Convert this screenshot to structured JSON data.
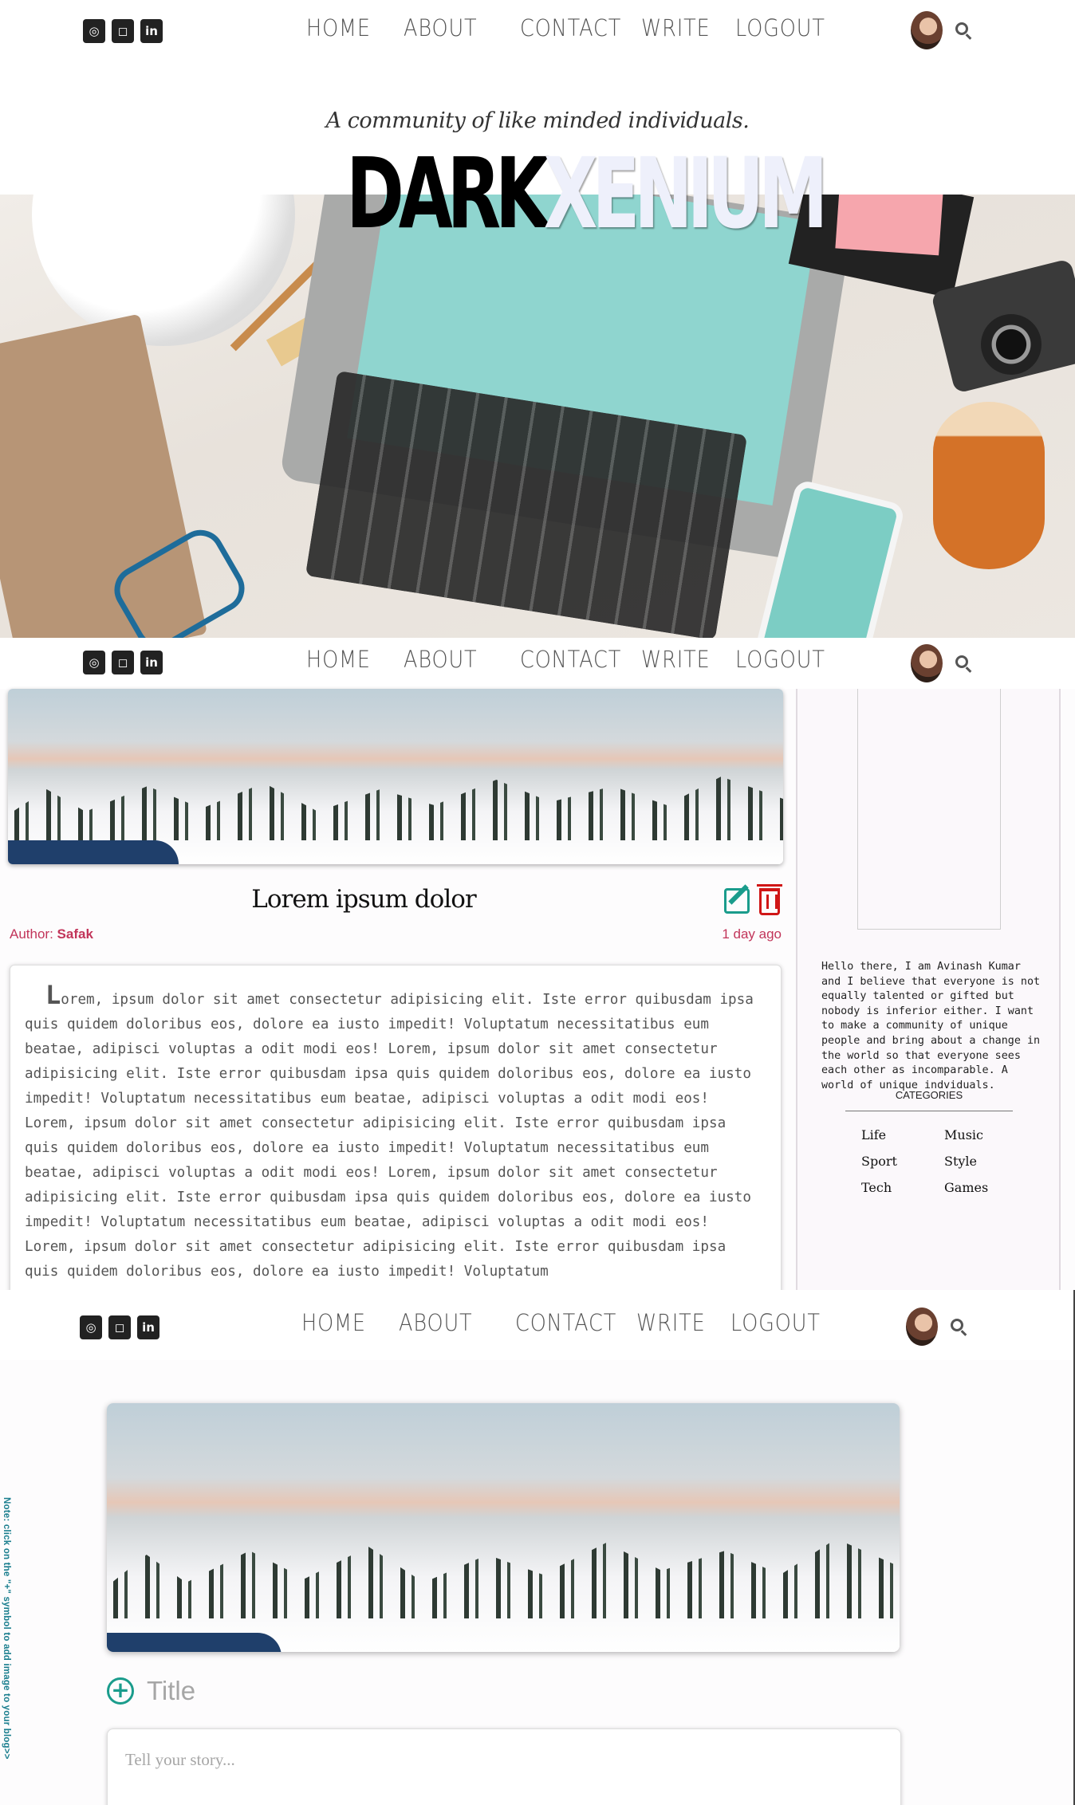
{
  "nav": {
    "social_icons": [
      "github-icon",
      "instagram-icon",
      "linkedin-icon"
    ],
    "items": [
      "HOME",
      "ABOUT",
      "CONTACT",
      "WRITE",
      "LOGOUT"
    ]
  },
  "hero": {
    "tagline": "A community of like minded individuals.",
    "logo_dark": "DARK",
    "logo_light": "XENIUM"
  },
  "post": {
    "title": "Lorem ipsum dolor",
    "author_label": "Author:",
    "author_name": "Safak",
    "time": "1 day ago",
    "body": "Lorem, ipsum dolor sit amet consectetur adipisicing elit. Iste error quibusdam ipsa quis quidem doloribus eos, dolore ea iusto impedit! Voluptatum necessitatibus eum beatae, adipisci voluptas a odit modi eos! Lorem, ipsum dolor sit amet consectetur adipisicing elit. Iste error quibusdam ipsa quis quidem doloribus eos, dolore ea iusto impedit! Voluptatum necessitatibus eum beatae, adipisci voluptas a odit modi eos! Lorem, ipsum dolor sit amet consectetur adipisicing elit. Iste error quibusdam ipsa quis quidem doloribus eos, dolore ea iusto impedit! Voluptatum necessitatibus eum beatae, adipisci voluptas a odit modi eos! Lorem, ipsum dolor sit amet consectetur adipisicing elit. Iste error quibusdam ipsa quis quidem doloribus eos, dolore ea iusto impedit! Voluptatum necessitatibus eum beatae, adipisci voluptas a odit modi eos! Lorem, ipsum dolor sit amet consectetur adipisicing elit. Iste error quibusdam ipsa quis quidem doloribus eos, dolore ea iusto impedit! Voluptatum"
  },
  "sidebar": {
    "about": "Hello there, I am Avinash Kumar and I believe that everyone is not equally talented or gifted but nobody is inferior either. I want to make a community of unique people and bring about a change in the world so that everyone sees each other as incomparable. A world of unique indviduals.",
    "categories_title": "CATEGORIES",
    "categories": [
      "Life",
      "Music",
      "Sport",
      "Style",
      "Tech",
      "Games"
    ]
  },
  "write": {
    "side_note": "Note: click on the \"+\" symbol to add image to your blog>>",
    "plus": "+",
    "title_placeholder": "Title",
    "story_placeholder": "Tell your story..."
  },
  "colors": {
    "accent_teal": "#1a9c8c",
    "delete_red": "#d01616",
    "author_pink": "#c2355a"
  }
}
